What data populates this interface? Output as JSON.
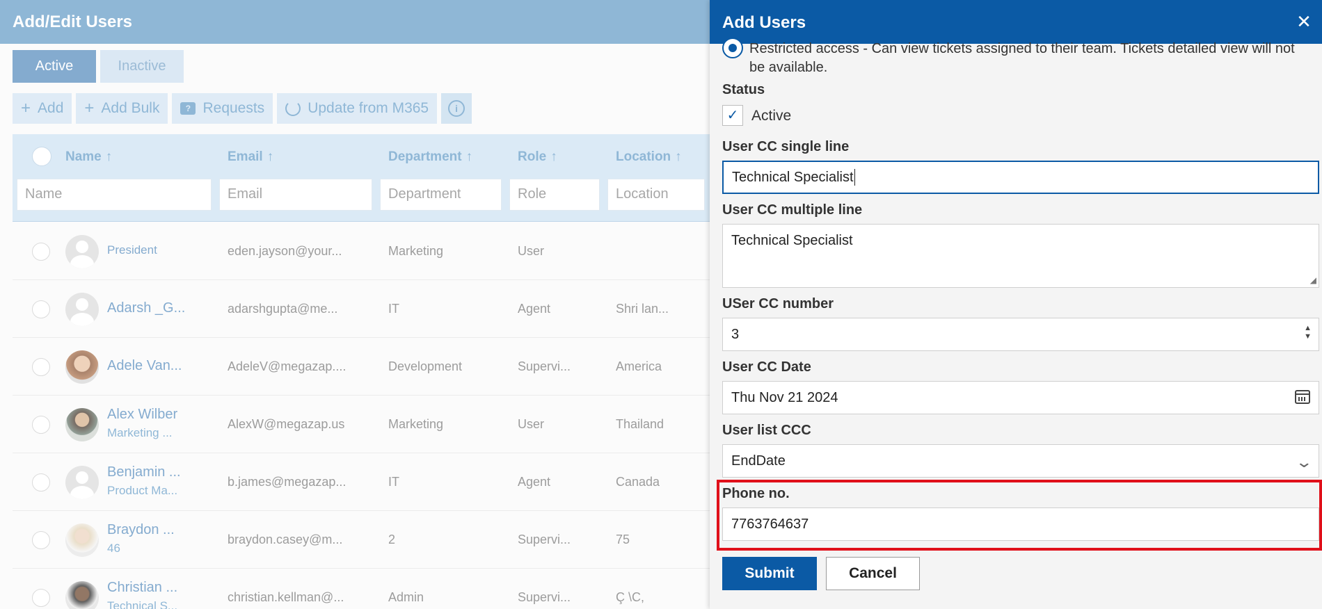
{
  "page": {
    "title": "Add/Edit Users",
    "tabs": {
      "active": "Active",
      "inactive": "Inactive"
    },
    "toolbar": {
      "add": "Add",
      "add_bulk": "Add Bulk",
      "requests": "Requests",
      "update": "Update from M365",
      "info_icon": "i"
    },
    "columns": {
      "name": "Name",
      "email": "Email",
      "department": "Department",
      "role": "Role",
      "location": "Location",
      "sort_arrow": "↑"
    },
    "filters": {
      "name": "Name",
      "email": "Email",
      "department": "Department",
      "role": "Role",
      "location": "Location"
    },
    "rows": [
      {
        "name": "President",
        "sub": "",
        "email": "eden.jayson@your...",
        "department": "Marketing",
        "role": "User",
        "location": ""
      },
      {
        "name": "Adarsh _G...",
        "sub": "",
        "email": "adarshgupta@me...",
        "department": "IT",
        "role": "Agent",
        "location": "Shri lan..."
      },
      {
        "name": "Adele Van...",
        "sub": "",
        "email": "AdeleV@megazap....",
        "department": "Development",
        "role": "Supervi...",
        "location": "America"
      },
      {
        "name": "Alex Wilber",
        "sub": "Marketing ...",
        "email": "AlexW@megazap.us",
        "department": "Marketing",
        "role": "User",
        "location": "Thailand"
      },
      {
        "name": "Benjamin ...",
        "sub": "Product Ma...",
        "email": "b.james@megazap...",
        "department": "IT",
        "role": "Agent",
        "location": "Canada"
      },
      {
        "name": "Braydon ...",
        "sub": "46",
        "email": "braydon.casey@m...",
        "department": "2",
        "role": "Supervi...",
        "location": "75"
      },
      {
        "name": "Christian ...",
        "sub": "Technical S...",
        "email": "christian.kellman@...",
        "department": "Admin",
        "role": "Supervi...",
        "location": "Ç \\C,"
      }
    ]
  },
  "panel": {
    "title": "Add Users",
    "close": "✕",
    "restricted_text": "Restricted access - Can view tickets assigned to their team. Tickets detailed view will not be available.",
    "status_label": "Status",
    "status_check": "✓",
    "status_value": "Active",
    "single_line_label": "User CC single line",
    "single_line_value": "Technical Specialist",
    "multi_line_label": "User CC multiple line",
    "multi_line_value": "Technical Specialist",
    "number_label": "USer CC number",
    "number_value": "3",
    "date_label": "User CC Date",
    "date_value": "Thu Nov 21 2024",
    "list_label": "User list CCC",
    "list_value": "EndDate",
    "phone_label": "Phone no.",
    "phone_value": "7763764637",
    "submit": "Submit",
    "cancel": "Cancel"
  }
}
